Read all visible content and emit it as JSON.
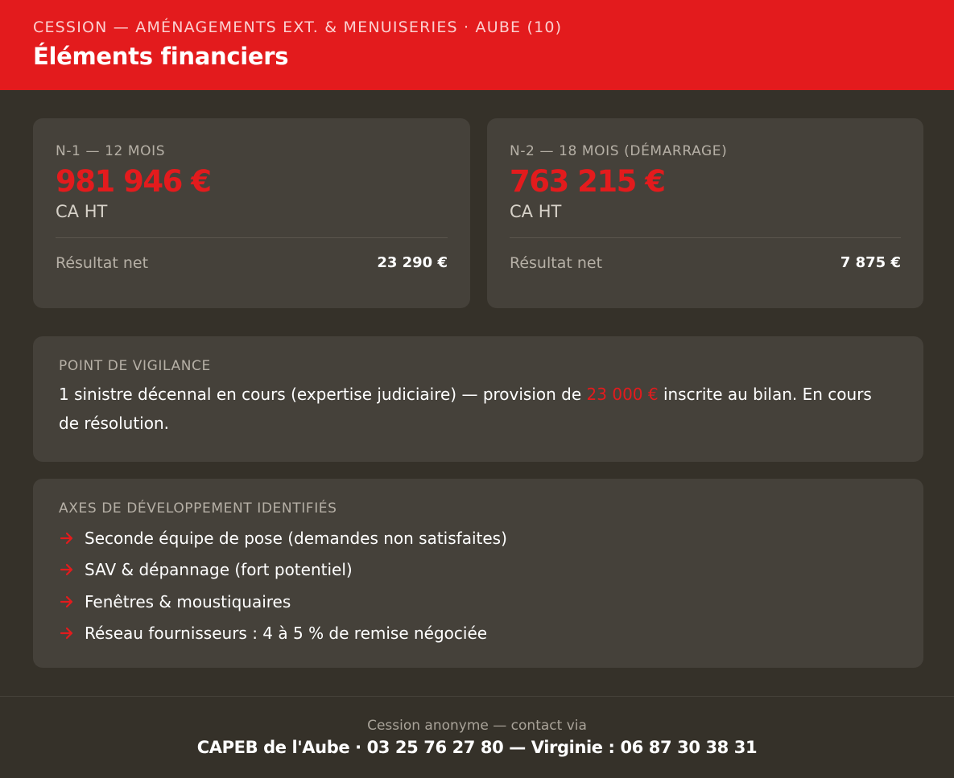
{
  "header": {
    "kicker": "CESSION — AMÉNAGEMENTS EXT. & MENUISERIES · AUBE (10)",
    "title": "Éléments financiers"
  },
  "financials": [
    {
      "period": "N-1 — 12 MOIS",
      "amount": "981 946 €",
      "amount_label": "CA HT",
      "result_label": "Résultat net",
      "result_value": "23 290 €"
    },
    {
      "period": "N-2 — 18 MOIS (DÉMARRAGE)",
      "amount": "763 215 €",
      "amount_label": "CA HT",
      "result_label": "Résultat net",
      "result_value": "7 875 €"
    }
  ],
  "vigilance": {
    "title": "POINT DE VIGILANCE",
    "text_before": "1 sinistre décennal en cours (expertise judiciaire) — provision de ",
    "highlight": "23 000 €",
    "text_after": " inscrite au bilan. En cours de résolution."
  },
  "axes": {
    "title": "AXES DE DÉVELOPPEMENT IDENTIFIÉS",
    "items": [
      "Seconde équipe de pose (demandes non satisfaites)",
      "SAV & dépannage (fort potentiel)",
      "Fenêtres & moustiquaires",
      "Réseau fournisseurs : 4 à 5 % de remise négociée"
    ],
    "bullet_icon": "arrow-right-icon"
  },
  "footer": {
    "line1": "Cession anonyme — contact via",
    "line2": "CAPEB de l'Aube · 03 25 76 27 80 — Virginie : 06 87 30 38 31"
  },
  "colors": {
    "accent": "#e31b1d",
    "background": "#353129",
    "card": "#45413a"
  }
}
